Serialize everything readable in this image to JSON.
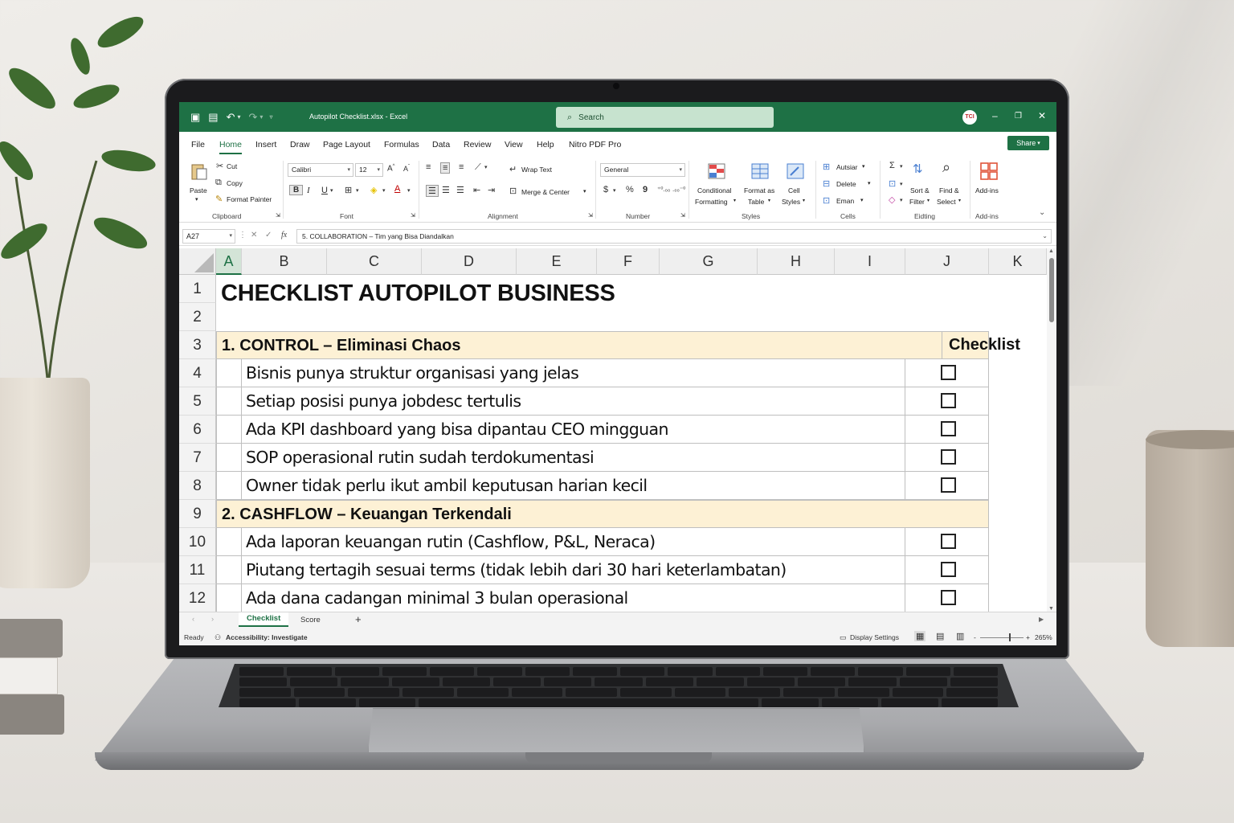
{
  "window": {
    "file_title": "Autopilot Checklist.xlsx",
    "app_name": "Excel",
    "title_separator": "-",
    "search_placeholder": "Search",
    "avatar_initials": "TCI",
    "minimize": "–",
    "restore": "❐",
    "close": "✕"
  },
  "menu": {
    "tabs": [
      "File",
      "Home",
      "Insert",
      "Draw",
      "Page Layout",
      "Formulas",
      "Data",
      "Review",
      "View",
      "Help",
      "Nitro PDF Pro"
    ],
    "active_tab": "Home",
    "share_label": "Share"
  },
  "ribbon": {
    "clipboard": {
      "paste": "Paste",
      "cut": "Cut",
      "copy": "Copy",
      "format_painter": "Format Painter",
      "label": "Clipboard"
    },
    "font": {
      "family": "Calibri",
      "size": "12",
      "label": "Font",
      "bold": "B",
      "italic": "I",
      "underline": "U"
    },
    "alignment": {
      "wrap_text": "Wrap Text",
      "merge_center": "Merge & Center",
      "label": "Alignment"
    },
    "number": {
      "format": "General",
      "label": "Number",
      "currency": "$",
      "percent": "%",
      "comma": "9"
    },
    "styles": {
      "conditional": "Conditional",
      "conditional2": "Formatting",
      "format_as": "Format as",
      "table": "Table",
      "cell": "Cell",
      "cell_styles": "Styles",
      "label": "Styles"
    },
    "cells": {
      "insert": "Autsiar",
      "delete": "Delete",
      "format": "Eman",
      "label": "Cells"
    },
    "editing": {
      "sort": "Sort &",
      "filter": "Filter",
      "find": "Find &",
      "select": "Select",
      "label": "Eidting"
    },
    "addins": {
      "addins": "Add-ins",
      "label": "Add-ins"
    }
  },
  "formula_bar": {
    "name_box": "A27",
    "fx": "fx",
    "content": "5. COLLABORATION – Tim yang Bisa Diandalkan"
  },
  "columns": [
    "A",
    "B",
    "C",
    "D",
    "E",
    "F",
    "G",
    "H",
    "I",
    "J",
    "K"
  ],
  "rows": [
    "1",
    "2",
    "3",
    "4",
    "5",
    "6",
    "7",
    "8",
    "9",
    "10",
    "11",
    "12"
  ],
  "sheet": {
    "title": "CHECKLIST AUTOPILOT BUSINESS",
    "checklist_header": "Checklist",
    "section1": "1. CONTROL – Eliminasi Chaos",
    "section1_items": [
      "Bisnis punya struktur organisasi yang jelas",
      "Setiap posisi punya jobdesc tertulis",
      "Ada KPI dashboard yang bisa dipantau CEO mingguan",
      "SOP operasional rutin sudah terdokumentasi",
      "Owner tidak perlu ikut ambil keputusan harian kecil"
    ],
    "section2": "2. CASHFLOW – Keuangan Terkendali",
    "section2_items": [
      "Ada laporan keuangan rutin (Cashflow, P&L, Neraca)",
      "Piutang tertagih sesuai terms (tidak lebih dari 30 hari keterlambatan)",
      "Ada dana cadangan minimal 3 bulan operasional"
    ]
  },
  "sheets": {
    "tabs": [
      "Checklist",
      "Score"
    ],
    "active": "Checklist",
    "add": "+"
  },
  "status": {
    "ready": "Ready",
    "accessibility": "Accessibility: Investigate",
    "display_settings": "Display Settings",
    "zoom": "265%"
  },
  "colors": {
    "excel_green": "#1e7145",
    "section_fill": "#fdf1d5"
  }
}
